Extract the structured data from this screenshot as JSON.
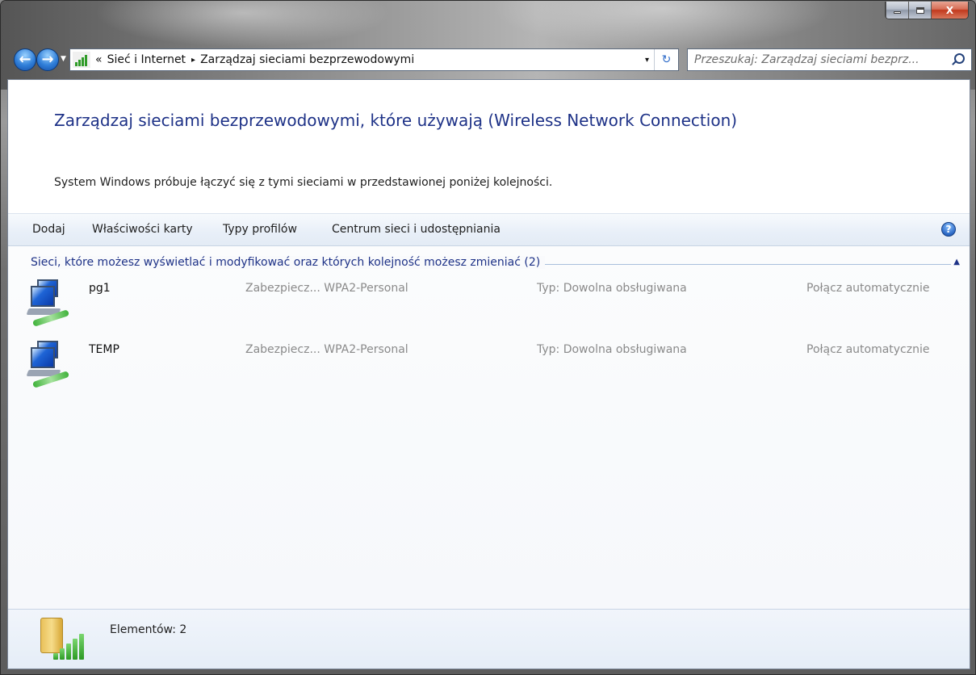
{
  "window": {
    "minimize_icon": "minimize-icon",
    "maximize_icon": "maximize-icon",
    "close_label": "X"
  },
  "address_bar": {
    "overflow": "«",
    "crumbs": [
      "Sieć i Internet",
      "Zarządzaj sieciami bezprzewodowymi"
    ],
    "separator": "▸",
    "dropdown": "▾",
    "refresh": "↻"
  },
  "search": {
    "placeholder": "Przeszukaj: Zarządzaj sieciami bezprz..."
  },
  "page": {
    "title": "Zarządzaj sieciami bezprzewodowymi, które używają (Wireless Network Connection)",
    "description": "System Windows próbuje łączyć się z tymi sieciami w przedstawionej poniżej kolejności."
  },
  "toolbar": {
    "items": [
      "Dodaj",
      "Właściwości karty",
      "Typy profilów",
      "Centrum sieci i udostępniania"
    ],
    "help": "?"
  },
  "group": {
    "header": "Sieci, które możesz wyświetlać i modyfikować oraz których kolejność możesz zmieniać (2)",
    "collapse": "▲"
  },
  "networks": [
    {
      "name": "pg1",
      "security": "Zabezpiecz... WPA2-Personal",
      "type": "Typ: Dowolna obsługiwana",
      "connect": "Połącz automatycznie"
    },
    {
      "name": "TEMP",
      "security": "Zabezpiecz... WPA2-Personal",
      "type": "Typ: Dowolna obsługiwana",
      "connect": "Połącz automatycznie"
    }
  ],
  "details": {
    "count": "Elementów: 2"
  },
  "colors": {
    "accent_blue": "#1e3287",
    "link_blue": "#1e3287",
    "secondary_text": "#8a8a8a",
    "close_red": "#c2391d"
  }
}
